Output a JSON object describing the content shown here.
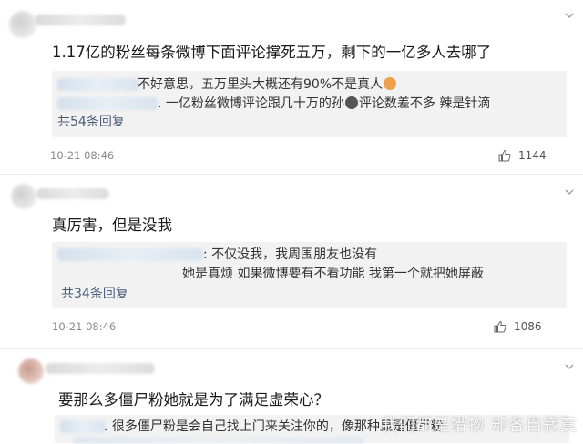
{
  "comments": [
    {
      "text": "1.17亿的粉丝每条微博下面评论撑死五万，剩下的一亿多人去哪了",
      "replies": [
        {
          "text": "不好意思，五万里头大概还有90%不是真人"
        },
        {
          "text": ". 一亿粉丝微博评论跟几十万的孙",
          "text_after_icon": "评论数差不多 辣是针滴"
        }
      ],
      "more_replies": "共54条回复",
      "time": "10-21 08:46",
      "likes": "1144"
    },
    {
      "text": "真厉害，但是没我",
      "replies": [
        {
          "text": ": 不仅没我，我周围朋友也没有"
        },
        {
          "text": "她是真烦 如果微博要有不看功能 我第一个就把她屏蔽"
        }
      ],
      "more_replies": "共34条回复",
      "time": "10-21 08:46",
      "likes": "1086"
    },
    {
      "text": "要那么多僵尸粉她就是为了满足虚荣心？",
      "replies": [
        {
          "text": ". 很多僵尸粉是会自己找上门来关注你的，像那种显是僵尸粉"
        }
      ]
    }
  ],
  "watermark": "我们都是猎物 却各自寂寞",
  "colors": {
    "reply_background": "#f2f2f2",
    "link": "#4a5d7a",
    "timestamp": "#8a8a8a",
    "like_icon": "#666666"
  },
  "icons": {
    "like": "thumbs-up-icon",
    "menu": "chevron-down-icon",
    "emoji_inline": "face-emoji-icon"
  }
}
